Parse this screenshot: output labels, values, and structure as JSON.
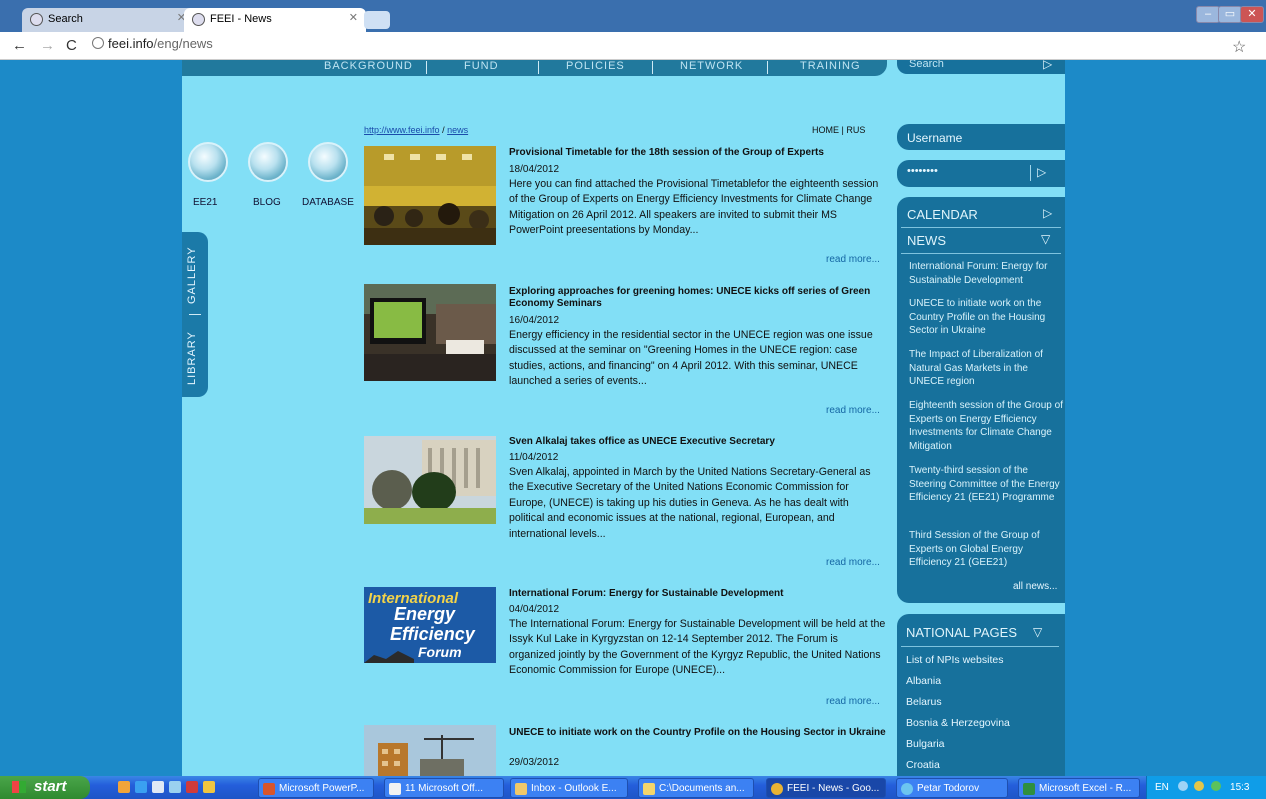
{
  "browser": {
    "tabs": [
      {
        "label": "Search"
      },
      {
        "label": "FEEI - News"
      }
    ],
    "url_host": "feei.info",
    "url_path": "/eng/news"
  },
  "site": {
    "topnav": [
      "BACKGROUND",
      "FUND",
      "POLICIES",
      "NETWORK",
      "TRAINING"
    ],
    "search_placeholder": "Search",
    "quick_links": [
      "EE21",
      "BLOG",
      "DATABASE"
    ],
    "side_tabs": [
      "GALLERY",
      "LIBRARY"
    ],
    "breadcrumb": {
      "site": "http://www.feei.info",
      "sep": "/",
      "page": "news"
    },
    "home_rus": "HOME | RUS",
    "read_more": "read more...",
    "articles": [
      {
        "title": "Provisional Timetable for the 18th session of the Group of Experts",
        "date": "18/04/2012",
        "body": "Here you can find attached the Provisional Timetablefor the eighteenth session of the Group of Experts on Energy Efficiency Investments for Climate Change Mitigation on 26 April 2012. All speakers are invited to submit their MS PowerPoint preesentations by Monday..."
      },
      {
        "title": "Exploring approaches for greening homes: UNECE kicks off series of Green Economy Seminars",
        "date": "16/04/2012",
        "body": "Energy efficiency in the residential sector in the UNECE region was one issue discussed at the seminar on \"Greening Homes in the UNECE region: case studies, actions, and financing\" on 4 April 2012. With this seminar, UNECE launched a series of events..."
      },
      {
        "title": "Sven Alkalaj takes office as UNECE Executive Secretary",
        "date": "11/04/2012",
        "body": "Sven Alkalaj, appointed in March by the United Nations Secretary-General as the Executive Secretary of the United Nations Economic Commission for Europe, (UNECE) is taking up his duties in Geneva. As he has dealt with political and economic issues at the national, regional, European, and international levels..."
      },
      {
        "title": "International Forum: Energy for Sustainable Development",
        "date": "04/04/2012",
        "body": "The International Forum: Energy for Sustainable Development will be held at the Issyk Kul Lake in Kyrgyzstan on 12-14 September 2012. The Forum is organized jointly by the Government of the Kyrgyz Republic, the United Nations Economic Commission for Europe (UNECE)..."
      },
      {
        "title": "UNECE to initiate work on the Country Profile on the Housing Sector in Ukraine",
        "date": "29/03/2012",
        "body": ""
      }
    ],
    "forum_logo": {
      "line1": "International",
      "line2": "Energy",
      "line3": "Efficiency",
      "line4": "Forum"
    },
    "sidebar": {
      "username": "Username",
      "password": "••••••••",
      "calendar": "CALENDAR",
      "news": "NEWS",
      "news_items": [
        "International Forum: Energy for Sustainable Development",
        "UNECE to initiate work on the Country Profile on the Housing Sector in Ukraine",
        "The Impact of Liberalization of Natural Gas Markets in the UNECE region",
        "Eighteenth session of the Group of Experts on Energy Efficiency Investments for Climate Change Mitigation",
        "Twenty-third session of the Steering Committee of the Energy Efficiency 21 (EE21) Programme",
        "Third Session of the Group of Experts on Global Energy Efficiency 21 (GEE21)"
      ],
      "all_news": "all news...",
      "national_pages": "NATIONAL PAGES",
      "national_items": [
        "List of NPIs websites",
        "Albania",
        "Belarus",
        "Bosnia & Herzegovina",
        "Bulgaria",
        "Croatia"
      ]
    }
  },
  "taskbar": {
    "start": "start",
    "items": [
      "Microsoft PowerP...",
      "11 Microsoft Off...",
      "Inbox - Outlook E...",
      "C:\\Documents an...",
      "FEEI - News - Goo...",
      "Petar Todorov",
      "Microsoft Excel - R..."
    ],
    "tray": "EN",
    "clock": "15:3"
  }
}
